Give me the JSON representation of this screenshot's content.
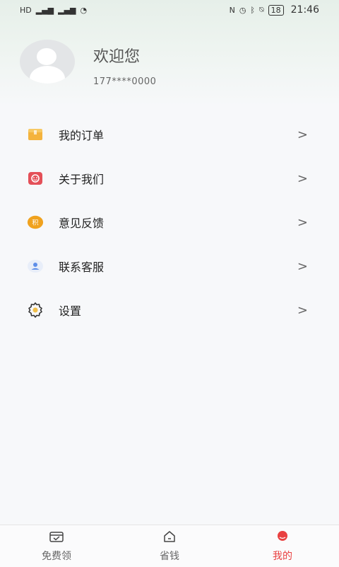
{
  "status_bar": {
    "time": "21:46",
    "battery": "18"
  },
  "profile": {
    "welcome": "欢迎您",
    "phone": "177****0000"
  },
  "menu": [
    {
      "label": "我的订单",
      "icon": "order-box-icon"
    },
    {
      "label": "关于我们",
      "icon": "smile-face-icon"
    },
    {
      "label": "意见反馈",
      "icon": "feedback-badge-icon"
    },
    {
      "label": "联系客服",
      "icon": "customer-service-icon"
    },
    {
      "label": "设置",
      "icon": "gear-icon"
    }
  ],
  "tabs": [
    {
      "label": "免费领",
      "icon": "calendar-check-icon",
      "active": false
    },
    {
      "label": "省钱",
      "icon": "home-icon",
      "active": false
    },
    {
      "label": "我的",
      "icon": "profile-icon",
      "active": true
    }
  ],
  "colors": {
    "accent": "#e94040",
    "order_icon": "#f4b33d",
    "about_icon": "#e45058",
    "feedback_icon": "#f0a21e",
    "service_icon": "#5d8ee8"
  }
}
